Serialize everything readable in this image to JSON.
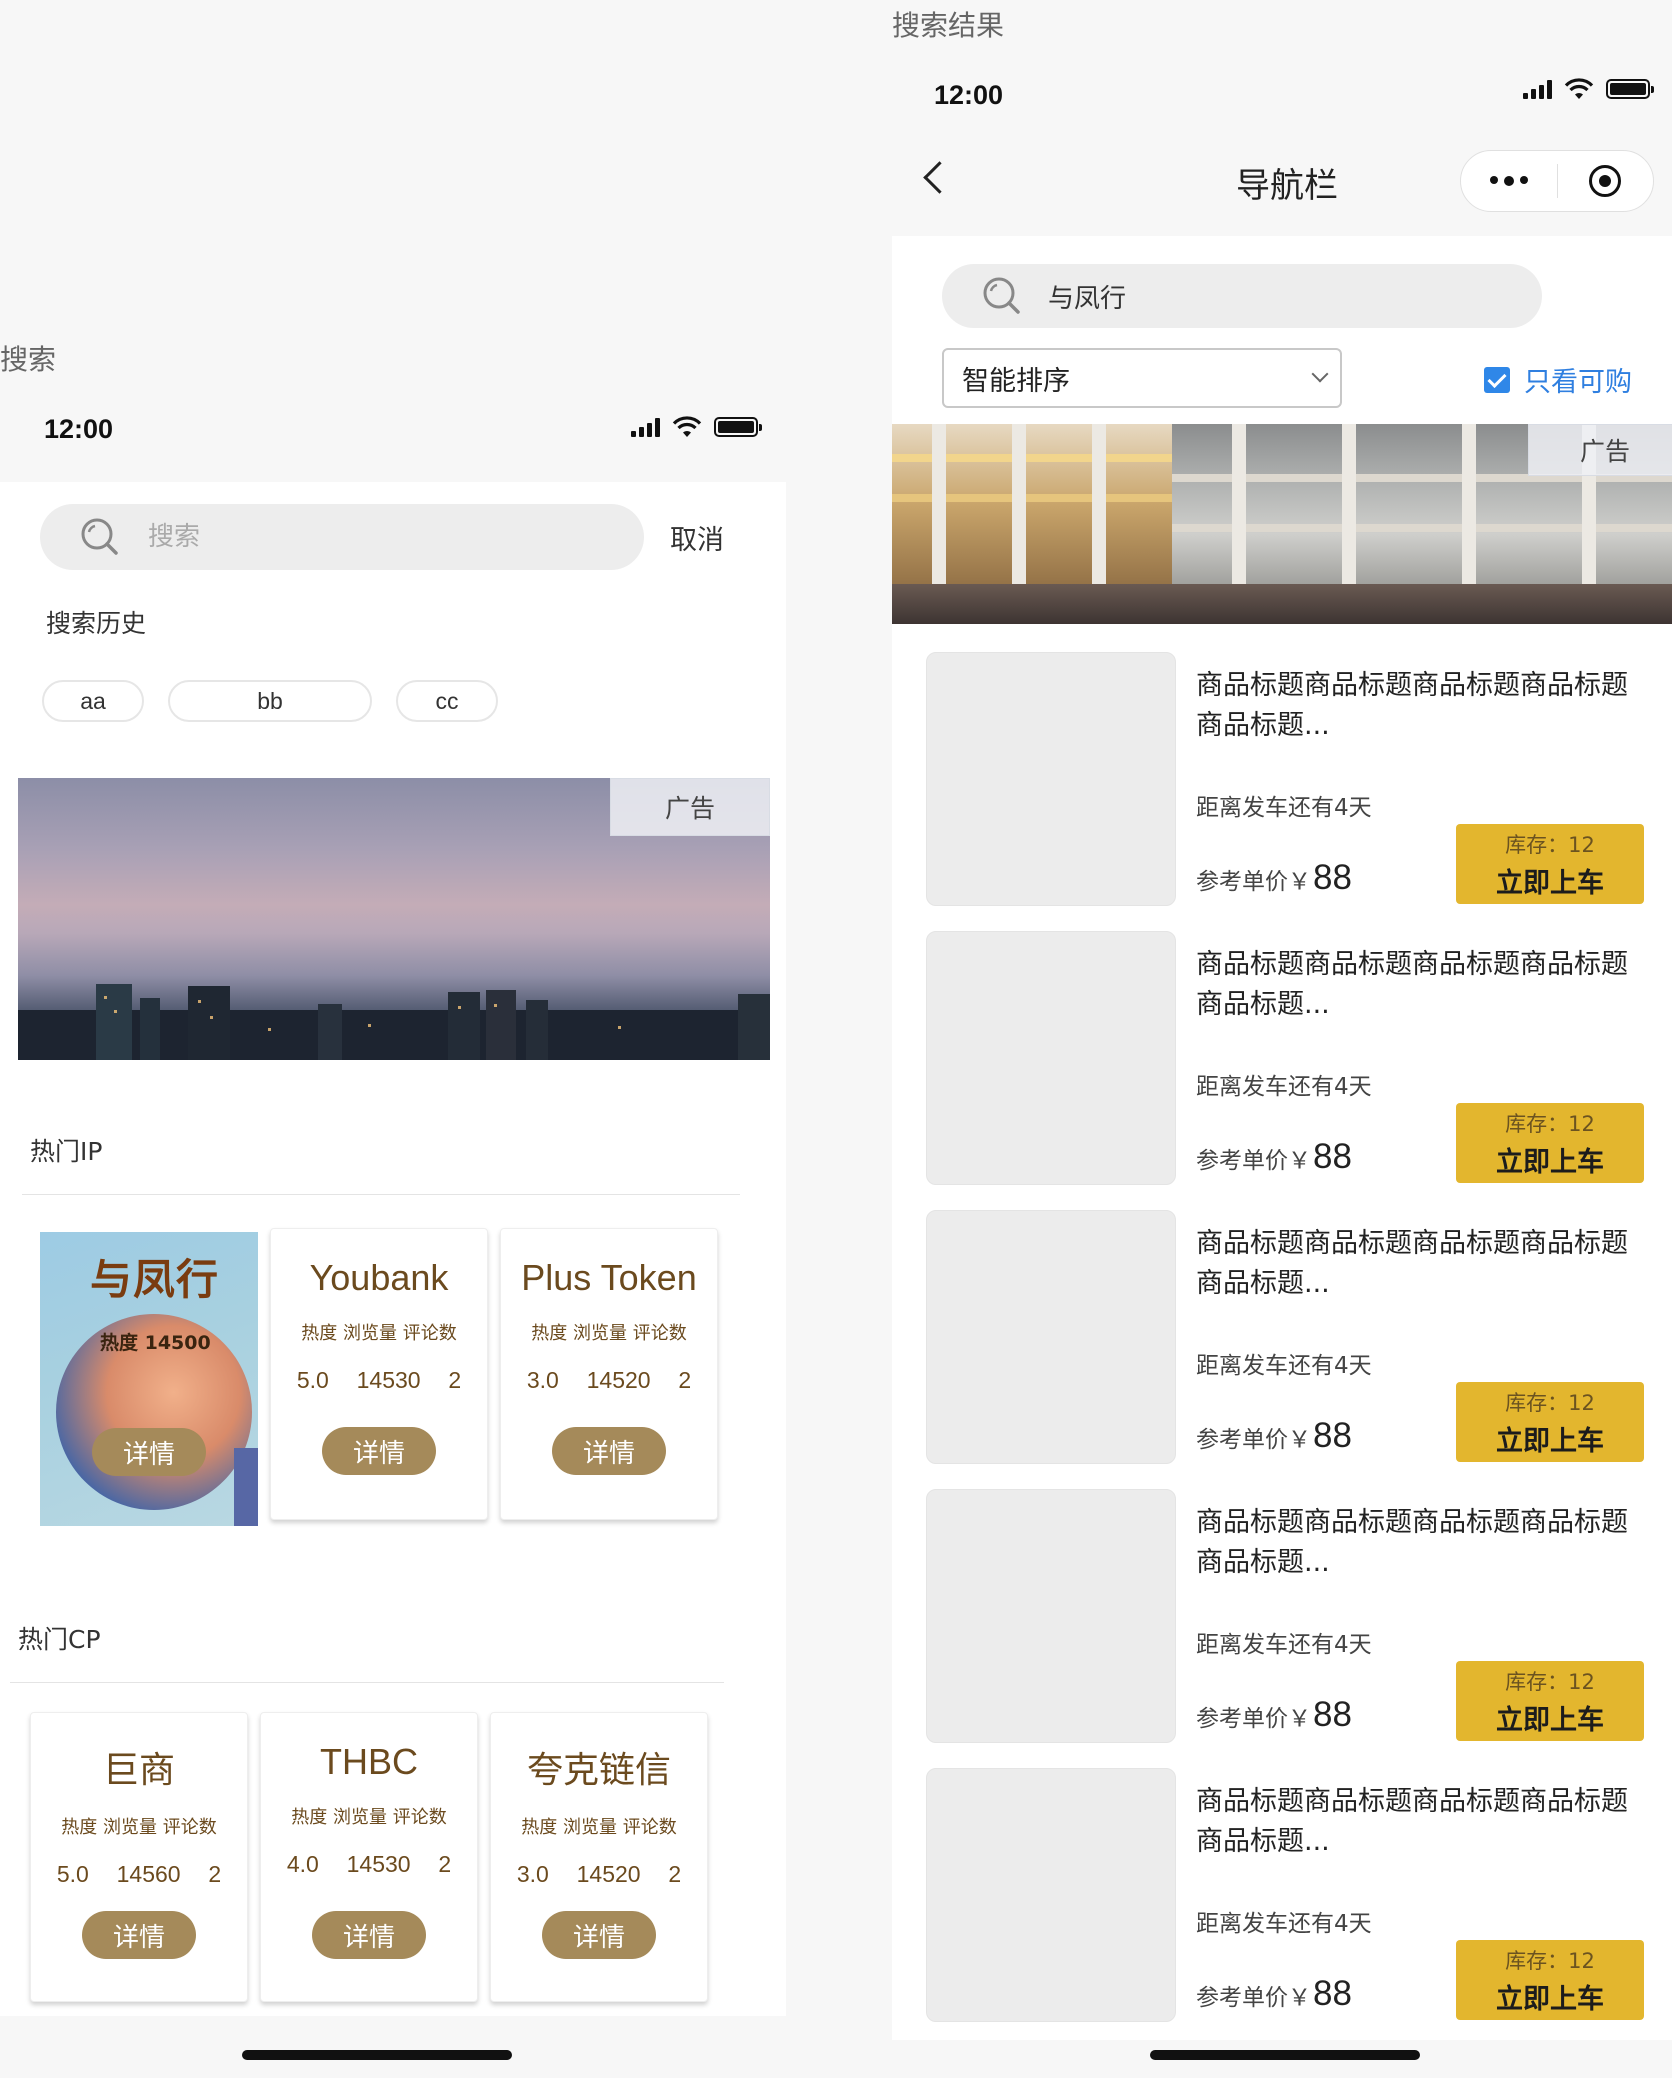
{
  "left_screen": {
    "label": "搜索",
    "status_time": "12:00",
    "search": {
      "placeholder": "搜索",
      "cancel": "取消"
    },
    "history": {
      "title": "搜索历史",
      "tags": [
        "aa",
        "bb",
        "cc"
      ]
    },
    "ad_tag": "广告",
    "hot_ip": {
      "title": "热门IP",
      "poster": {
        "title": "与凤行",
        "heat": "热度 14500",
        "button": "详情"
      },
      "cards": [
        {
          "name": "Youbank",
          "labels": "热度 浏览量 评论数",
          "heat": "5.0",
          "views": "14530",
          "comments": "2",
          "button": "详情"
        },
        {
          "name": "Plus Token",
          "labels": "热度 浏览量 评论数",
          "heat": "3.0",
          "views": "14520",
          "comments": "2",
          "button": "详情"
        }
      ]
    },
    "hot_cp": {
      "title": "热门CP",
      "cards": [
        {
          "name": "巨商",
          "labels": "热度 浏览量 评论数",
          "heat": "5.0",
          "views": "14560",
          "comments": "2",
          "button": "详情"
        },
        {
          "name": "THBC",
          "labels": "热度 浏览量 评论数",
          "heat": "4.0",
          "views": "14530",
          "comments": "2",
          "button": "详情"
        },
        {
          "name": "夸克链信",
          "labels": "热度 浏览量 评论数",
          "heat": "3.0",
          "views": "14520",
          "comments": "2",
          "button": "详情"
        }
      ]
    }
  },
  "right_screen": {
    "label": "搜索结果",
    "status_time": "12:00",
    "nav_title": "导航栏",
    "search_value": "与凤行",
    "sort": "智能排序",
    "only_buy": "只看可购",
    "ad_tag": "广告",
    "products": [
      {
        "title": "商品标题商品标题商品标题商品标题商品标题...",
        "depart": "距离发车还有4天",
        "price_label": "参考单价￥",
        "price": "88",
        "stock": "库存：12",
        "button": "立即上车"
      },
      {
        "title": "商品标题商品标题商品标题商品标题商品标题...",
        "depart": "距离发车还有4天",
        "price_label": "参考单价￥",
        "price": "88",
        "stock": "库存：12",
        "button": "立即上车"
      },
      {
        "title": "商品标题商品标题商品标题商品标题商品标题...",
        "depart": "距离发车还有4天",
        "price_label": "参考单价￥",
        "price": "88",
        "stock": "库存：12",
        "button": "立即上车"
      },
      {
        "title": "商品标题商品标题商品标题商品标题商品标题...",
        "depart": "距离发车还有4天",
        "price_label": "参考单价￥",
        "price": "88",
        "stock": "库存：12",
        "button": "立即上车"
      },
      {
        "title": "商品标题商品标题商品标题商品标题商品标题...",
        "depart": "距离发车还有4天",
        "price_label": "参考单价￥",
        "price": "88",
        "stock": "库存：12",
        "button": "立即上车"
      }
    ]
  },
  "colors": {
    "accent_gold": "#e3b62e",
    "detail_brown": "#a58a5a",
    "link_blue": "#2f7fe0",
    "text_brown": "#6b4a1e"
  }
}
